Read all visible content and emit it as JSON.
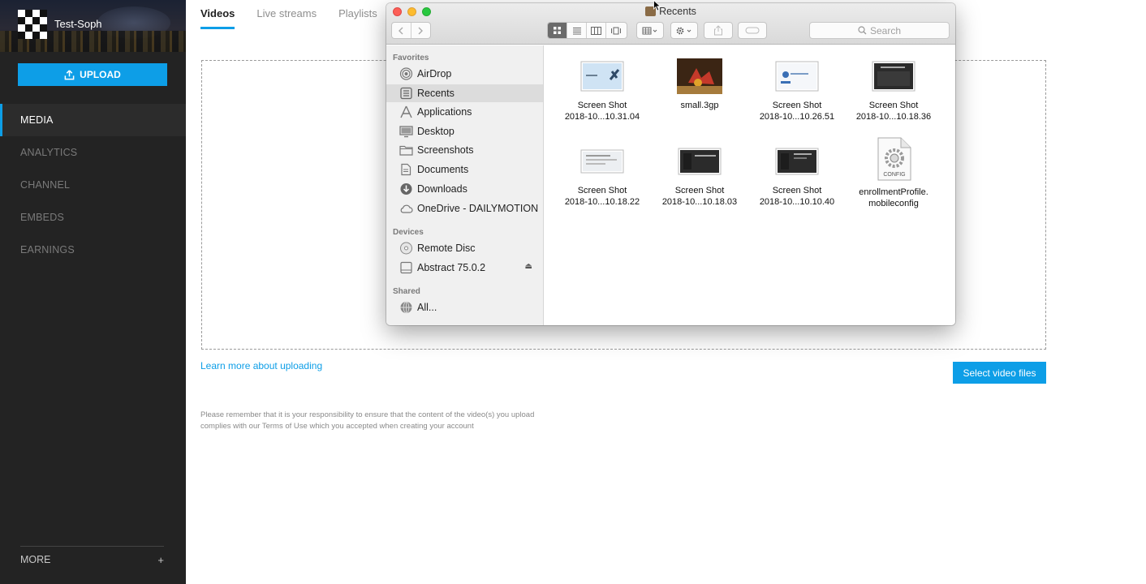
{
  "sidebar": {
    "username": "Test-Soph",
    "upload_label": "UPLOAD",
    "nav": [
      {
        "label": "MEDIA",
        "active": true
      },
      {
        "label": "ANALYTICS",
        "active": false
      },
      {
        "label": "CHANNEL",
        "active": false
      },
      {
        "label": "EMBEDS",
        "active": false
      },
      {
        "label": "EARNINGS",
        "active": false
      }
    ],
    "more_label": "MORE",
    "more_plus": "+"
  },
  "main": {
    "tabs": [
      {
        "label": "Videos",
        "active": true
      },
      {
        "label": "Live streams",
        "active": false
      },
      {
        "label": "Playlists",
        "active": false
      }
    ],
    "learn_more": "Learn more about uploading",
    "select_button": "Select video files",
    "notice_line1": "Please remember that it is your responsibility to ensure that the content of the video(s) you upload",
    "notice_line2": "complies with our Terms of Use which you accepted when creating your account"
  },
  "finder": {
    "title": "Recents",
    "search_placeholder": "Search",
    "sections": {
      "favorites": "Favorites",
      "devices": "Devices",
      "shared": "Shared"
    },
    "favorites": [
      {
        "label": "AirDrop",
        "icon": "airdrop-icon"
      },
      {
        "label": "Recents",
        "icon": "recents-icon",
        "selected": true
      },
      {
        "label": "Applications",
        "icon": "applications-icon"
      },
      {
        "label": "Desktop",
        "icon": "desktop-icon"
      },
      {
        "label": "Screenshots",
        "icon": "folder-icon"
      },
      {
        "label": "Documents",
        "icon": "documents-icon"
      },
      {
        "label": "Downloads",
        "icon": "downloads-icon"
      },
      {
        "label": "OneDrive - DAILYMOTION",
        "icon": "cloud-icon"
      }
    ],
    "devices": [
      {
        "label": "Remote Disc",
        "icon": "disc-icon"
      },
      {
        "label": "Abstract 75.0.2",
        "icon": "drive-icon",
        "eject": "⏏"
      }
    ],
    "shared": [
      {
        "label": "All...",
        "icon": "network-icon"
      }
    ],
    "files": [
      {
        "line1": "Screen Shot",
        "line2": "2018-10...10.31.04",
        "kind": "screenshot-light"
      },
      {
        "line1": "small.3gp",
        "line2": "",
        "kind": "video"
      },
      {
        "line1": "Screen Shot",
        "line2": "2018-10...10.26.51",
        "kind": "screenshot-light"
      },
      {
        "line1": "Screen Shot",
        "line2": "2018-10...10.18.36",
        "kind": "screenshot-dark"
      },
      {
        "line1": "Screen Shot",
        "line2": "2018-10...10.18.22",
        "kind": "screenshot-light"
      },
      {
        "line1": "Screen Shot",
        "line2": "2018-10...10.18.03",
        "kind": "screenshot-dark"
      },
      {
        "line1": "Screen Shot",
        "line2": "2018-10...10.10.40",
        "kind": "screenshot-dark"
      },
      {
        "line1": "enrollmentProfile.",
        "line2": "mobileconfig",
        "kind": "config",
        "badge": "CONFIG"
      }
    ]
  },
  "colors": {
    "accent": "#0d9ee7",
    "sidebar_bg": "#232323"
  }
}
